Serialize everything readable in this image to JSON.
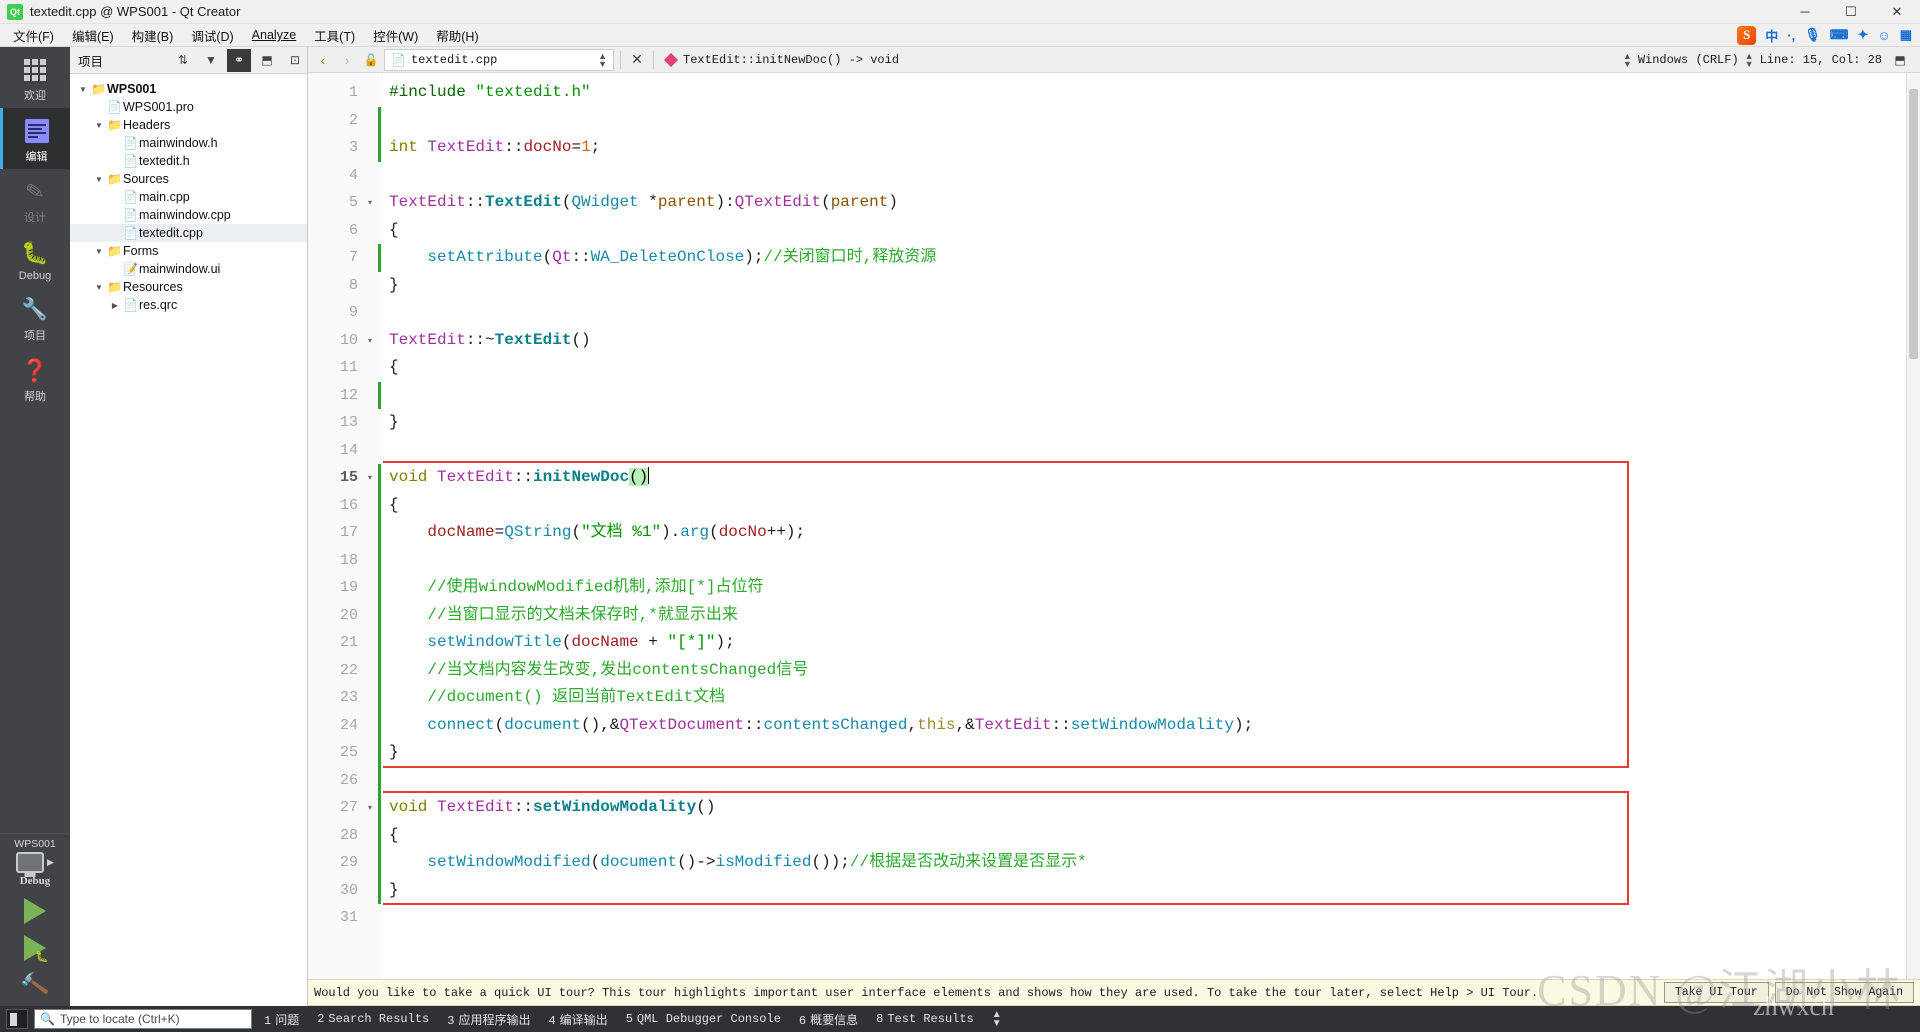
{
  "window": {
    "title": "textedit.cpp @ WPS001 - Qt Creator",
    "app_badge": "Qt",
    "minimize": "─",
    "maximize": "☐",
    "close": "✕"
  },
  "menubar": {
    "items": [
      {
        "label": "文件(F)"
      },
      {
        "label": "编辑(E)"
      },
      {
        "label": "构建(B)"
      },
      {
        "label": "调试(D)"
      },
      {
        "label": "Analyze"
      },
      {
        "label": "工具(T)"
      },
      {
        "label": "控件(W)"
      },
      {
        "label": "帮助(H)"
      }
    ]
  },
  "tray": {
    "items": [
      {
        "name": "sogou-ime-icon",
        "glyph": "S"
      },
      {
        "name": "ime-chinese-icon",
        "glyph": "中"
      },
      {
        "name": "ime-punctuation-icon",
        "glyph": "·,"
      },
      {
        "name": "microphone-icon",
        "glyph": "⬤"
      },
      {
        "name": "keyboard-icon",
        "glyph": "⌨"
      },
      {
        "name": "toolbox-icon",
        "glyph": "✦"
      },
      {
        "name": "emoji-icon",
        "glyph": "☺"
      },
      {
        "name": "apps-icon",
        "glyph": "▦"
      }
    ]
  },
  "modebar": {
    "modes": [
      {
        "name": "welcome",
        "label": "欢迎",
        "icon": "grid-icon",
        "state": "normal"
      },
      {
        "name": "edit",
        "label": "编辑",
        "icon": "edit-icon",
        "state": "active"
      },
      {
        "name": "design",
        "label": "设计",
        "icon": "pencil-icon",
        "state": "disabled"
      },
      {
        "name": "debug",
        "label": "Debug",
        "icon": "bug-icon",
        "state": "normal"
      },
      {
        "name": "projects",
        "label": "项目",
        "icon": "wrench-icon",
        "state": "normal"
      },
      {
        "name": "help",
        "label": "帮助",
        "icon": "question-icon",
        "state": "normal"
      }
    ],
    "kit": {
      "project_name": "WPS001",
      "build_config": "Debug",
      "run_label": "▶",
      "debug_label": "▶",
      "build_label": "🔨"
    }
  },
  "projects_panel": {
    "title": "项目",
    "toolbar": [
      {
        "name": "sort-toggle-icon",
        "glyph": "⇅"
      },
      {
        "name": "filter-icon",
        "glyph": "▼"
      },
      {
        "name": "sync-selection-icon",
        "glyph": "⚭"
      },
      {
        "name": "split-icon",
        "glyph": "⬒"
      },
      {
        "name": "close-panel-icon",
        "glyph": "⊡"
      }
    ],
    "tree": [
      {
        "label": "WPS001",
        "depth": 0,
        "arrow": "▼",
        "icon": "📁",
        "bold": true,
        "selected": false
      },
      {
        "label": "WPS001.pro",
        "depth": 1,
        "arrow": "",
        "icon": "📄",
        "bold": false,
        "selected": false
      },
      {
        "label": "Headers",
        "depth": 1,
        "arrow": "▼",
        "icon": "📁",
        "bold": false,
        "selected": false
      },
      {
        "label": "mainwindow.h",
        "depth": 2,
        "arrow": "",
        "icon": "📄",
        "bold": false,
        "selected": false
      },
      {
        "label": "textedit.h",
        "depth": 2,
        "arrow": "",
        "icon": "📄",
        "bold": false,
        "selected": false
      },
      {
        "label": "Sources",
        "depth": 1,
        "arrow": "▼",
        "icon": "📁",
        "bold": false,
        "selected": false
      },
      {
        "label": "main.cpp",
        "depth": 2,
        "arrow": "",
        "icon": "📄",
        "bold": false,
        "selected": false
      },
      {
        "label": "mainwindow.cpp",
        "depth": 2,
        "arrow": "",
        "icon": "📄",
        "bold": false,
        "selected": false
      },
      {
        "label": "textedit.cpp",
        "depth": 2,
        "arrow": "",
        "icon": "📄",
        "bold": false,
        "selected": true
      },
      {
        "label": "Forms",
        "depth": 1,
        "arrow": "▼",
        "icon": "📁",
        "bold": false,
        "selected": false
      },
      {
        "label": "mainwindow.ui",
        "depth": 2,
        "arrow": "",
        "icon": "📝",
        "bold": false,
        "selected": false
      },
      {
        "label": "Resources",
        "depth": 1,
        "arrow": "▼",
        "icon": "📁",
        "bold": false,
        "selected": false
      },
      {
        "label": "res.qrc",
        "depth": 2,
        "arrow": "▶",
        "icon": "📄",
        "bold": false,
        "selected": false
      }
    ]
  },
  "editor_toolbar": {
    "back_icon": "‹",
    "forward_icon": "›",
    "lock_icon": "🔓",
    "file_name": "textedit.cpp",
    "file_icon": "📄",
    "close_icon": "✕",
    "symbol": "TextEdit::initNewDoc() -> void",
    "line_ending": "Windows (CRLF)",
    "cursor_position": "Line: 15, Col: 28",
    "split_icon": "⬒"
  },
  "code": {
    "total_lines": 31,
    "current_line": 15,
    "lines": [
      {
        "n": 1,
        "fold": "",
        "changed": false,
        "tokens": [
          {
            "t": "#include ",
            "c": "pp"
          },
          {
            "t": "\"textedit.h\"",
            "c": "str"
          }
        ]
      },
      {
        "n": 2,
        "fold": "",
        "changed": true,
        "tokens": []
      },
      {
        "n": 3,
        "fold": "",
        "changed": true,
        "tokens": [
          {
            "t": "int",
            "c": "k"
          },
          {
            "t": " ",
            "c": "op"
          },
          {
            "t": "TextEdit",
            "c": "typ"
          },
          {
            "t": "::",
            "c": "op"
          },
          {
            "t": "docNo",
            "c": "var"
          },
          {
            "t": "=",
            "c": "op"
          },
          {
            "t": "1",
            "c": "num"
          },
          {
            "t": ";",
            "c": "op"
          }
        ]
      },
      {
        "n": 4,
        "fold": "",
        "changed": false,
        "tokens": []
      },
      {
        "n": 5,
        "fold": "▾",
        "changed": false,
        "tokens": [
          {
            "t": "TextEdit",
            "c": "typ"
          },
          {
            "t": "::",
            "c": "op"
          },
          {
            "t": "TextEdit",
            "c": "fn"
          },
          {
            "t": "(",
            "c": "op"
          },
          {
            "t": "QWidget",
            "c": "fn2"
          },
          {
            "t": " *",
            "c": "op"
          },
          {
            "t": "parent",
            "c": "prm"
          },
          {
            "t": "):",
            "c": "op"
          },
          {
            "t": "QTextEdit",
            "c": "typ"
          },
          {
            "t": "(",
            "c": "op"
          },
          {
            "t": "parent",
            "c": "prm"
          },
          {
            "t": ")",
            "c": "op"
          }
        ]
      },
      {
        "n": 6,
        "fold": "",
        "changed": false,
        "tokens": [
          {
            "t": "{",
            "c": "op"
          }
        ]
      },
      {
        "n": 7,
        "fold": "",
        "changed": true,
        "tokens": [
          {
            "t": "    ",
            "c": "op"
          },
          {
            "t": "setAttribute",
            "c": "fn2"
          },
          {
            "t": "(",
            "c": "op"
          },
          {
            "t": "Qt",
            "c": "typ"
          },
          {
            "t": "::",
            "c": "op"
          },
          {
            "t": "WA_DeleteOnClose",
            "c": "fn2"
          },
          {
            "t": ");",
            "c": "op"
          },
          {
            "t": "//关闭窗口时,释放资源",
            "c": "cmt"
          }
        ]
      },
      {
        "n": 8,
        "fold": "",
        "changed": false,
        "tokens": [
          {
            "t": "}",
            "c": "op"
          }
        ]
      },
      {
        "n": 9,
        "fold": "",
        "changed": false,
        "tokens": []
      },
      {
        "n": 10,
        "fold": "▾",
        "changed": false,
        "tokens": [
          {
            "t": "TextEdit",
            "c": "typ"
          },
          {
            "t": "::~",
            "c": "op"
          },
          {
            "t": "TextEdit",
            "c": "fn"
          },
          {
            "t": "()",
            "c": "op"
          }
        ]
      },
      {
        "n": 11,
        "fold": "",
        "changed": false,
        "tokens": [
          {
            "t": "{",
            "c": "op"
          }
        ]
      },
      {
        "n": 12,
        "fold": "",
        "changed": true,
        "tokens": []
      },
      {
        "n": 13,
        "fold": "",
        "changed": false,
        "tokens": [
          {
            "t": "}",
            "c": "op"
          }
        ]
      },
      {
        "n": 14,
        "fold": "",
        "changed": false,
        "tokens": []
      },
      {
        "n": 15,
        "fold": "▾",
        "changed": false,
        "tokens": [
          {
            "t": "void",
            "c": "k"
          },
          {
            "t": " ",
            "c": "op"
          },
          {
            "t": "TextEdit",
            "c": "typ"
          },
          {
            "t": "::",
            "c": "op"
          },
          {
            "t": "initNewDoc",
            "c": "fn"
          },
          {
            "t": "()",
            "c": "hl-paren"
          }
        ]
      },
      {
        "n": 16,
        "fold": "",
        "changed": false,
        "tokens": [
          {
            "t": "{",
            "c": "op"
          }
        ]
      },
      {
        "n": 17,
        "fold": "",
        "changed": false,
        "tokens": [
          {
            "t": "    ",
            "c": "op"
          },
          {
            "t": "docName",
            "c": "var"
          },
          {
            "t": "=",
            "c": "op"
          },
          {
            "t": "QString",
            "c": "fn2"
          },
          {
            "t": "(",
            "c": "op"
          },
          {
            "t": "\"文档 %1\"",
            "c": "str"
          },
          {
            "t": ").",
            "c": "op"
          },
          {
            "t": "arg",
            "c": "fn2"
          },
          {
            "t": "(",
            "c": "op"
          },
          {
            "t": "docNo",
            "c": "var"
          },
          {
            "t": "++);",
            "c": "op"
          }
        ]
      },
      {
        "n": 18,
        "fold": "",
        "changed": false,
        "tokens": []
      },
      {
        "n": 19,
        "fold": "",
        "changed": false,
        "tokens": [
          {
            "t": "    //使用windowModified机制,添加[*]占位符",
            "c": "cmt"
          }
        ]
      },
      {
        "n": 20,
        "fold": "",
        "changed": false,
        "tokens": [
          {
            "t": "    //当窗口显示的文档未保存时,*就显示出来",
            "c": "cmt"
          }
        ]
      },
      {
        "n": 21,
        "fold": "",
        "changed": false,
        "tokens": [
          {
            "t": "    ",
            "c": "op"
          },
          {
            "t": "setWindowTitle",
            "c": "fn2"
          },
          {
            "t": "(",
            "c": "op"
          },
          {
            "t": "docName",
            "c": "var"
          },
          {
            "t": " + ",
            "c": "op"
          },
          {
            "t": "\"[*]\"",
            "c": "str"
          },
          {
            "t": ");",
            "c": "op"
          }
        ]
      },
      {
        "n": 22,
        "fold": "",
        "changed": false,
        "tokens": [
          {
            "t": "    //当文档内容发生改变,发出contentsChanged信号",
            "c": "cmt"
          }
        ]
      },
      {
        "n": 23,
        "fold": "",
        "changed": false,
        "tokens": [
          {
            "t": "    //document() 返回当前TextEdit文档",
            "c": "cmt"
          }
        ]
      },
      {
        "n": 24,
        "fold": "",
        "changed": false,
        "tokens": [
          {
            "t": "    ",
            "c": "op"
          },
          {
            "t": "connect",
            "c": "fn2"
          },
          {
            "t": "(",
            "c": "op"
          },
          {
            "t": "document",
            "c": "fn2"
          },
          {
            "t": "(),&",
            "c": "op"
          },
          {
            "t": "QTextDocument",
            "c": "typ"
          },
          {
            "t": "::",
            "c": "op"
          },
          {
            "t": "contentsChanged",
            "c": "fn2"
          },
          {
            "t": ",",
            "c": "op"
          },
          {
            "t": "this",
            "c": "this"
          },
          {
            "t": ",&",
            "c": "op"
          },
          {
            "t": "TextEdit",
            "c": "typ"
          },
          {
            "t": "::",
            "c": "op"
          },
          {
            "t": "setWindowModality",
            "c": "fn2"
          },
          {
            "t": ");",
            "c": "op"
          }
        ]
      },
      {
        "n": 25,
        "fold": "",
        "changed": false,
        "tokens": [
          {
            "t": "}",
            "c": "op"
          }
        ]
      },
      {
        "n": 26,
        "fold": "",
        "changed": false,
        "tokens": []
      },
      {
        "n": 27,
        "fold": "▾",
        "changed": false,
        "tokens": [
          {
            "t": "void",
            "c": "k"
          },
          {
            "t": " ",
            "c": "op"
          },
          {
            "t": "TextEdit",
            "c": "typ"
          },
          {
            "t": "::",
            "c": "op"
          },
          {
            "t": "setWindowModality",
            "c": "fn"
          },
          {
            "t": "()",
            "c": "op"
          }
        ]
      },
      {
        "n": 28,
        "fold": "",
        "changed": false,
        "tokens": [
          {
            "t": "{",
            "c": "op"
          }
        ]
      },
      {
        "n": 29,
        "fold": "",
        "changed": false,
        "tokens": [
          {
            "t": "    ",
            "c": "op"
          },
          {
            "t": "setWindowModified",
            "c": "fn2"
          },
          {
            "t": "(",
            "c": "op"
          },
          {
            "t": "document",
            "c": "fn2"
          },
          {
            "t": "()->",
            "c": "op"
          },
          {
            "t": "isModified",
            "c": "fn2"
          },
          {
            "t": "());",
            "c": "op"
          },
          {
            "t": "//根据是否改动来设置是否显示*",
            "c": "cmt"
          }
        ]
      },
      {
        "n": 30,
        "fold": "",
        "changed": false,
        "tokens": [
          {
            "t": "}",
            "c": "op"
          }
        ]
      },
      {
        "n": 31,
        "fold": "",
        "changed": false,
        "tokens": []
      }
    ],
    "annotations": [
      {
        "name": "highlight-box-initnewdoc",
        "first_line": 15,
        "last_line": 25,
        "color": "#e83b33"
      },
      {
        "name": "highlight-box-setwindowmodality",
        "first_line": 27,
        "last_line": 30,
        "color": "#e83b33"
      }
    ]
  },
  "tour_banner": {
    "message": "Would you like to take a quick UI tour? This tour highlights important user interface elements and shows how they are used. To take the tour later, select Help > UI Tour.",
    "take_tour_label": "Take UI Tour",
    "dismiss_label": "Do Not Show Again"
  },
  "statusbar": {
    "sidebar_toggle_icon": "sidebar-toggle-icon",
    "locator_placeholder": "Type to locate (Ctrl+K)",
    "search_icon": "🔍",
    "panes": [
      {
        "num": "1",
        "label": "问题"
      },
      {
        "num": "2",
        "label": "Search Results"
      },
      {
        "num": "3",
        "label": "应用程序输出"
      },
      {
        "num": "4",
        "label": "编译输出"
      },
      {
        "num": "5",
        "label": "QML Debugger Console"
      },
      {
        "num": "6",
        "label": "概要信息"
      },
      {
        "num": "8",
        "label": "Test Results"
      }
    ],
    "expand_icon": "⇅"
  },
  "watermark": {
    "text": "CSDN @江湖小林",
    "handle": "zhwxch"
  }
}
